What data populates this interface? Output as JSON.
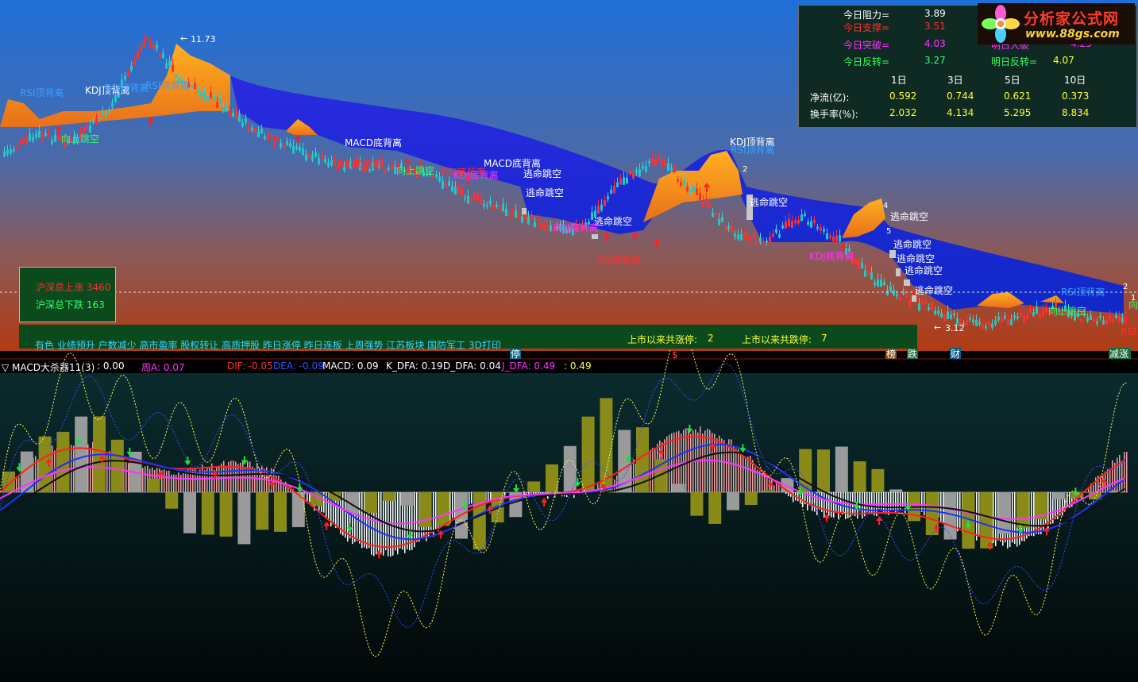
{
  "price_panel": {
    "high_label": "11.73",
    "low_label": "3.12",
    "annotations": [
      {
        "text": "RSI顶背离",
        "color": "#3aa0ff"
      },
      {
        "text": "KDJ顶背离",
        "color": "#ffffff"
      },
      {
        "text": "RSI顶背离",
        "color": "#3aa0ff"
      },
      {
        "text": "向上跳空",
        "color": "#33ff66"
      },
      {
        "text": "MACD底背离",
        "color": "#ffffff"
      },
      {
        "text": "RSI底背离",
        "color": "#ff3030"
      },
      {
        "text": "向上跳空",
        "color": "#33ff66"
      },
      {
        "text": "RSI底背离",
        "color": "#ff3030"
      },
      {
        "text": "MACD底背离",
        "color": "#ffffff"
      },
      {
        "text": "KDJ底背离",
        "color": "#ff33ff"
      },
      {
        "text": "逃命跳空",
        "color": "#ffffff"
      },
      {
        "text": "逃命跳空",
        "color": "#ffffff"
      },
      {
        "text": "逃命跳空",
        "color": "#ffffff"
      },
      {
        "text": "RSI底背离",
        "color": "#ff3030"
      },
      {
        "text": "KDJ顶背离",
        "color": "#ffffff"
      },
      {
        "text": "RSI顶背离",
        "color": "#3aa0ff"
      },
      {
        "text": "逃命跳空",
        "color": "#ffffff"
      },
      {
        "text": "KDJ底背离",
        "color": "#ff33ff"
      },
      {
        "text": "逃命跳空",
        "color": "#ffffff"
      },
      {
        "text": "逃命跳空",
        "color": "#ffffff"
      },
      {
        "text": "逃命跳空",
        "color": "#ffffff"
      },
      {
        "text": "逃命跳空",
        "color": "#ffffff"
      },
      {
        "text": "逃命跳空",
        "color": "#ffffff"
      },
      {
        "text": "RSI顶背离",
        "color": "#3aa0ff"
      },
      {
        "text": "向上跳空",
        "color": "#33ff66"
      },
      {
        "text": "向上跳空",
        "color": "#33ff66"
      },
      {
        "text": "RSI顶背离",
        "color": "#3aa0ff"
      },
      {
        "text": "KDJ底背离",
        "color": "#ff33ff"
      },
      {
        "text": "RSI",
        "color": "#ff3030"
      }
    ],
    "wave_numbers": [
      "2",
      "4",
      "5",
      "1",
      "2"
    ],
    "updown_box": {
      "up": "沪深总上涨 3460",
      "down": "沪深总下跌 163"
    },
    "concepts": "有色 业绩预升 户数减少 高市盈率 股权转让 高质押股 昨日涨停 昨日连板 上周强势 江苏板块 国防军工 3D打印",
    "limit_up_label": "上市以来共涨停:",
    "limit_up_value": "2",
    "limit_down_label": "上市以来共跌停:",
    "limit_down_value": "7",
    "bottom_markers": [
      "停",
      "$",
      "榜",
      "跌",
      "财",
      "减涨"
    ]
  },
  "info_panel": {
    "rows": [
      {
        "label": "今日阻力=",
        "value": "3.89",
        "label_color": "#ffffff",
        "value_color": "#ffffff"
      },
      {
        "label": "今日支撑=",
        "value": "3.51",
        "label_color": "#ff3030",
        "value_color": "#ff3030"
      },
      {
        "label": "今日突破=",
        "value": "4.03",
        "label_color": "#ff33ff",
        "value_color": "#ff33ff"
      },
      {
        "label": "今日反转=",
        "value": "3.27",
        "label_color": "#33ff66",
        "value_color": "#33ff66"
      }
    ],
    "tomorrow_partial": {
      "label": "明日大破",
      "value": "4.25"
    },
    "tomorrow_reverse": {
      "label": "明日反转=",
      "value": "4.07"
    },
    "period_headers": [
      "1日",
      "3日",
      "5日",
      "10日"
    ],
    "netflow": {
      "label": "净流(亿):",
      "values": [
        "0.592",
        "0.744",
        "0.621",
        "0.373"
      ]
    },
    "turnover": {
      "label": "换手率(%):",
      "values": [
        "2.032",
        "4.134",
        "5.295",
        "8.834"
      ]
    }
  },
  "logo": {
    "title": "分析家公式网",
    "url": "www.88gs.com"
  },
  "indicator_bar": {
    "name": "▽ MACD大杀器11(3)",
    "items": [
      {
        "text": ": 0.00",
        "color": "#ffffff"
      },
      {
        "text": "周A: 0.07",
        "color": "#ff33ff"
      },
      {
        "text": "DIF: -0.05",
        "color": "#ff3030"
      },
      {
        "text": "DEA: -0.09",
        "color": "#3050ff"
      },
      {
        "text": "MACD: 0.09",
        "color": "#ffffff"
      },
      {
        "text": "K_DFA: 0.19",
        "color": "#ffffff"
      },
      {
        "text": "D_DFA: 0.04",
        "color": "#ffffff"
      },
      {
        "text": "J_DFA: 0.49",
        "color": "#ff33ff"
      },
      {
        "text": ": 0.49",
        "color": "#ffff33"
      }
    ]
  },
  "colors": {
    "bg_top": "#1f6fd9",
    "bg_bottom": "#b23a12",
    "cloud": "#1a1fd0",
    "orange": "#ff8a1a",
    "dif": "#ff2020",
    "dea": "#2030ff",
    "olive": "#8a8a18"
  },
  "chart_data": {
    "type": "line",
    "price_high": 11.73,
    "price_low": 3.12,
    "close_approx": [
      8.2,
      8.8,
      8.6,
      9.6,
      11.73,
      10.4,
      9.8,
      8.9,
      8.4,
      8.0,
      7.8,
      7.9,
      7.5,
      6.9,
      6.5,
      6.1,
      6.0,
      7.4,
      8.1,
      7.2,
      6.0,
      5.6,
      6.4,
      5.7,
      4.4,
      3.9,
      3.4,
      3.12,
      3.4,
      3.6,
      3.3,
      3.4
    ],
    "macd_bars": [
      0.2,
      0.6,
      0.8,
      0.3,
      -0.4,
      -0.5,
      -0.3,
      -0.2,
      -0.1,
      -0.3,
      -0.6,
      -0.2,
      0.4,
      0.9,
      0.5,
      -0.2,
      -0.3,
      0.3,
      0.6,
      0.2,
      -0.5,
      -0.7,
      -0.3,
      -0.1,
      0.09
    ]
  }
}
